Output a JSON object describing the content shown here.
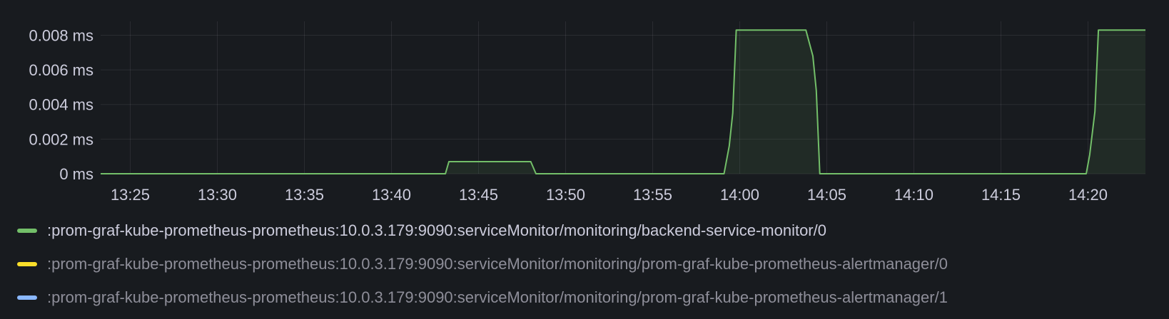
{
  "chart_data": {
    "type": "area",
    "x_ticks": [
      "13:25",
      "13:30",
      "13:35",
      "13:40",
      "13:45",
      "13:50",
      "13:55",
      "14:00",
      "14:05",
      "14:10",
      "14:15",
      "14:20"
    ],
    "y_ticks": [
      "0 ms",
      "0.002 ms",
      "0.004 ms",
      "0.006 ms",
      "0.008 ms"
    ],
    "y_tick_values": [
      0,
      0.002,
      0.004,
      0.006,
      0.008
    ],
    "xlim": [
      "13:23.3",
      "14:23.3"
    ],
    "ylim": [
      0,
      0.0088
    ],
    "grid": true,
    "legend_position": "bottom",
    "series": [
      {
        "name": ":prom-graf-kube-prometheus-prometheus:10.0.3.179:9090:serviceMonitor/monitoring/backend-service-monitor/0",
        "color": "#73bf69",
        "visible": true,
        "points": [
          [
            "13:23.3",
            0
          ],
          [
            "13:43.1",
            0
          ],
          [
            "13:43.3",
            0.0007
          ],
          [
            "13:48.0",
            0.0007
          ],
          [
            "13:48.3",
            0
          ],
          [
            "13:59.1",
            0
          ],
          [
            "13:59.4",
            0.0016
          ],
          [
            "13:59.6",
            0.0035
          ],
          [
            "13:59.8",
            0.0083
          ],
          [
            "14:03.8",
            0.0083
          ],
          [
            "14:04.2",
            0.0068
          ],
          [
            "14:04.4",
            0.0048
          ],
          [
            "14:04.6",
            0
          ],
          [
            "14:19.9",
            0
          ],
          [
            "14:20.1",
            0.0011
          ],
          [
            "14:20.4",
            0.0036
          ],
          [
            "14:20.6",
            0.0083
          ],
          [
            "14:23.3",
            0.0083
          ]
        ]
      },
      {
        "name": ":prom-graf-kube-prometheus-prometheus:10.0.3.179:9090:serviceMonitor/monitoring/prom-graf-kube-prometheus-alertmanager/0",
        "color": "#fade2a",
        "visible": false,
        "points": []
      },
      {
        "name": ":prom-graf-kube-prometheus-prometheus:10.0.3.179:9090:serviceMonitor/monitoring/prom-graf-kube-prometheus-alertmanager/1",
        "color": "#8ab8ff",
        "visible": false,
        "points": []
      }
    ]
  }
}
